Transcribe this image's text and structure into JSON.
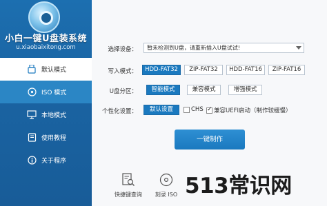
{
  "app": {
    "title": "小白一键U盘装系统",
    "url": "u.xiaobaixitong.com"
  },
  "sidebar": {
    "items": [
      {
        "label": "默认模式",
        "icon": "usb-drive-icon",
        "active": true
      },
      {
        "label": "ISO 模式",
        "icon": "disc-icon",
        "active": false
      },
      {
        "label": "本地模式",
        "icon": "monitor-icon",
        "active": false
      },
      {
        "label": "使用教程",
        "icon": "book-icon",
        "active": false
      },
      {
        "label": "关于程序",
        "icon": "info-icon",
        "active": false
      }
    ]
  },
  "form": {
    "device_label": "选择设备：",
    "device_value": "暂未检测到U盘，请重新插入U盘试试!",
    "write_label": "写入模式：",
    "write_modes": [
      "HDD-FAT32",
      "ZIP-FAT32",
      "HDD-FAT16",
      "ZIP-FAT16"
    ],
    "write_selected": "HDD-FAT32",
    "partition_label": "U盘分区：",
    "partition_modes": [
      "智能模式",
      "兼容模式",
      "增强模式"
    ],
    "partition_selected": "智能模式",
    "personal_label": "个性化设置：",
    "default_setting": "默认设置",
    "chs_label": "CHS",
    "chs_checked": false,
    "uefi_label": "兼容UEFI启动（制作较缓慢）",
    "uefi_checked": true,
    "make_button": "一键制作"
  },
  "tools": [
    {
      "label": "快捷键查询",
      "icon": "search-doc-icon"
    },
    {
      "label": "刻录 ISO",
      "icon": "burn-disc-icon"
    }
  ],
  "watermark": "513常识网",
  "colors": {
    "sidebar": "#1a64a3",
    "accent": "#1a79bf",
    "background": "#f7f8fa"
  }
}
